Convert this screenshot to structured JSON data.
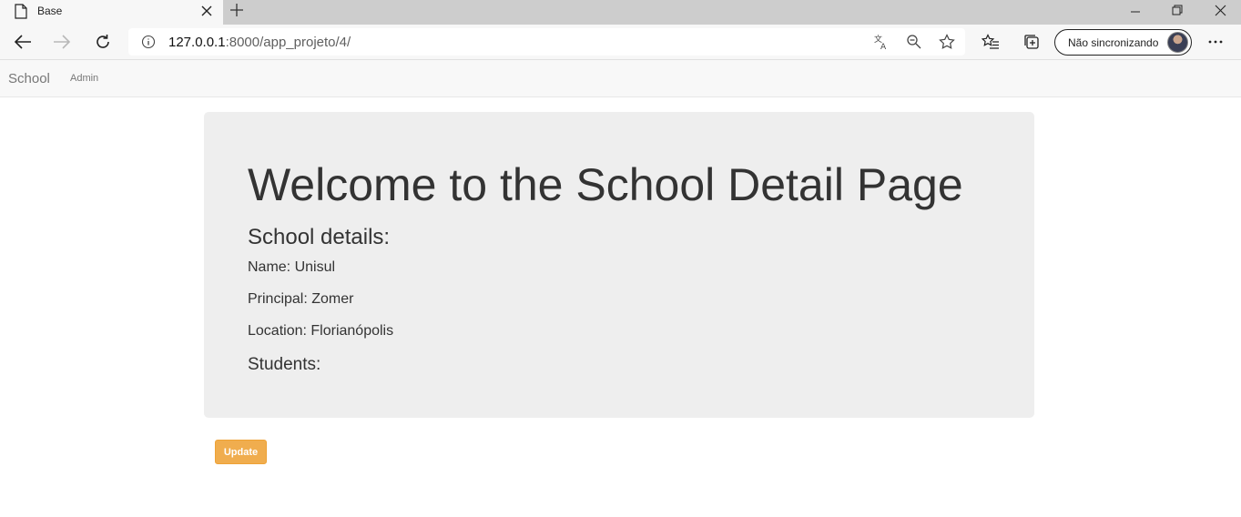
{
  "browser": {
    "tab_title": "Base",
    "url_host": "127.0.0.1",
    "url_rest": ":8000/app_projeto/4/",
    "sync_label": "Não sincronizando"
  },
  "navbar": {
    "brand": "School",
    "admin_link": "Admin"
  },
  "school": {
    "heading": "Welcome to the School Detail Page",
    "subheading": "School details:",
    "name_line": "Name: Unisul",
    "principal_line": "Principal: Zomer",
    "location_line": "Location: Florianópolis",
    "students_label": "Students:"
  },
  "actions": {
    "update_label": "Update"
  },
  "colors": {
    "accent_warning": "#f0ad4e",
    "jumbotron_bg": "#eeeeee"
  },
  "icons": [
    "page-icon",
    "close-icon",
    "plus-icon",
    "minimize-icon",
    "restore-icon",
    "window-close-icon",
    "back-icon",
    "forward-icon",
    "refresh-icon",
    "info-icon",
    "translate-icon",
    "zoom-icon",
    "star-icon",
    "favorites-icon",
    "collections-icon",
    "more-icon"
  ]
}
